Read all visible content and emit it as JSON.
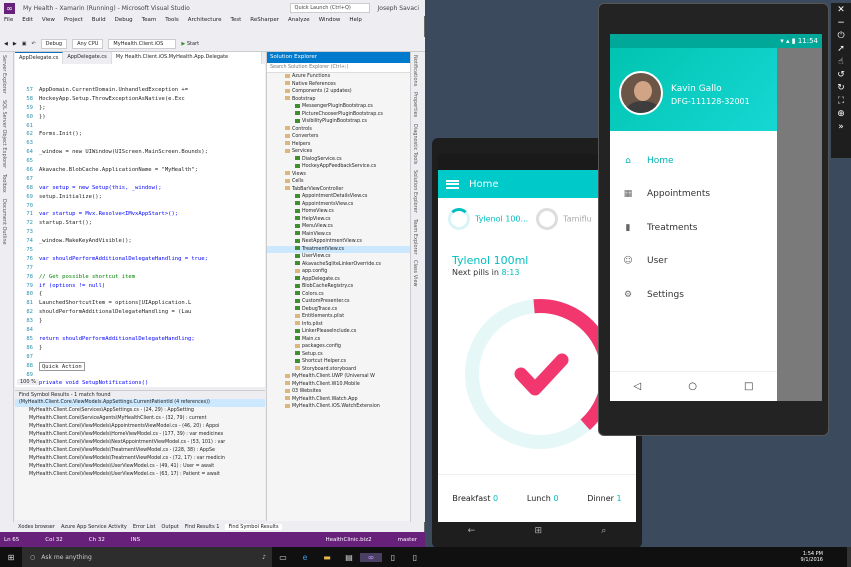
{
  "vs": {
    "title": "My Health - Xamarin (Running) - Microsoft Visual Studio",
    "menu": [
      "File",
      "Edit",
      "View",
      "Project",
      "Build",
      "Debug",
      "Team",
      "Tools",
      "Architecture",
      "Test",
      "ReSharper",
      "Analyze",
      "Window",
      "Help"
    ],
    "user": "Joseph Savaci",
    "quick_launch": "Quick Launch (Ctrl+Q)",
    "toolbar": {
      "config": "Debug",
      "platform": "Any CPU",
      "project": "MyHealth.Client.iOS",
      "start": "Start"
    },
    "side_tabs": [
      "Server Explorer",
      "SQL Server Object Explorer",
      "Toolbox",
      "Document Outline"
    ],
    "right_tabs": [
      "Notifications",
      "Properties",
      "Diagnostic Tools",
      "Solution Explorer",
      "Team Explorer",
      "Class View"
    ],
    "tabs": [
      "AppDelegate.cs",
      "AppDelegate.cs",
      "My Health.Client.iOS.MyHealth.App.Delegate"
    ],
    "code": [
      {
        "n": "57",
        "t": "AppDomain.CurrentDomain.UnhandledException +="
      },
      {
        "n": "58",
        "t": "    HockeyApp.Setup.ThrowExceptionAsNative(e.Exc"
      },
      {
        "n": "59",
        "t": "};"
      },
      {
        "n": "60",
        "t": "})"
      },
      {
        "n": "61",
        "t": ""
      },
      {
        "n": "62",
        "t": "Forms.Init();"
      },
      {
        "n": "63",
        "t": ""
      },
      {
        "n": "64",
        "t": "_window = new UIWindow(UIScreen.MainScreen.Bounds);"
      },
      {
        "n": "65",
        "t": ""
      },
      {
        "n": "66",
        "t": "Akavache.BlobCache.ApplicationName = \"MyHealth\";"
      },
      {
        "n": "67",
        "t": ""
      },
      {
        "n": "68",
        "t": "var setup = new Setup(this, _window);"
      },
      {
        "n": "69",
        "t": "setup.Initialize();"
      },
      {
        "n": "70",
        "t": ""
      },
      {
        "n": "71",
        "t": "var startup = Mvx.Resolve<IMvxAppStart>();"
      },
      {
        "n": "72",
        "t": "startup.Start();"
      },
      {
        "n": "73",
        "t": ""
      },
      {
        "n": "74",
        "t": "_window.MakeKeyAndVisible();"
      },
      {
        "n": "75",
        "t": ""
      },
      {
        "n": "76",
        "t": "var shouldPerformAdditionalDelegateHandling = true;"
      },
      {
        "n": "77",
        "t": ""
      },
      {
        "n": "78",
        "t": "// Get possible shortcut item"
      },
      {
        "n": "79",
        "t": "if (options != null)"
      },
      {
        "n": "80",
        "t": "{"
      },
      {
        "n": "81",
        "t": "    LaunchedShortcutItem = options[UIApplication.L"
      },
      {
        "n": "82",
        "t": "    shouldPerformAdditionalDelegateHandling = (Lau"
      },
      {
        "n": "83",
        "t": "}"
      },
      {
        "n": "84",
        "t": ""
      },
      {
        "n": "85",
        "t": "return shouldPerformAdditionalDelegateHandling;"
      },
      {
        "n": "86",
        "t": "}"
      },
      {
        "n": "87",
        "t": ""
      },
      {
        "n": "88",
        "t": "Quick Action"
      },
      {
        "n": "89",
        "t": ""
      },
      {
        "n": "177",
        "t": "private void SetupNotifications()"
      }
    ],
    "zoom": "100 %",
    "find_title": "Find Symbol Results - 1 match found",
    "find_rows": [
      "(MyHealth.Client.Core.ViewModels.AppSettings.CurrentPatientId (4 references))",
      "MyHealth.Client.Core\\Services\\AppSettings.cs - (24, 29) : AppSetting",
      "MyHealth.Client.Core\\ServiceAgents\\MyHealthClient.cs - (32, 79) : current",
      "MyHealth.Client.Core\\ViewModels\\AppointmentsViewModel.cs - (46, 20) : Appoi",
      "MyHealth.Client.Core\\ViewModels\\HomeViewModel.cs - (177, 39) : var medicines",
      "MyHealth.Client.Core\\ViewModels\\NextAppointmentViewModel.cs - (53, 101) : var",
      "MyHealth.Client.Core\\ViewModels\\TreatmentViewModel.cs - (228, 38) : AppSe",
      "MyHealth.Client.Core\\ViewModels\\TreatmentViewModel.cs - (72, 17) : var medicin",
      "MyHealth.Client.Core\\ViewModels\\UserViewModel.cs - (49, 41) : User = await",
      "MyHealth.Client.Core\\ViewModels\\UserViewModel.cs - (63, 17) : Patient = await"
    ],
    "bottom_tabs": [
      "Xodes browser",
      "Azure App Service Activity",
      "Error List",
      "Output",
      "Find Results 1",
      "Find Symbol Results"
    ],
    "status": {
      "ln": "Ln 65",
      "col": "Col 32",
      "ch": "Ch 32",
      "mode": "INS",
      "branch": "master",
      "project": "HealthClinic.biz2"
    },
    "solution": {
      "title": "Solution Explorer",
      "search": "Search Solution Explorer (Ctrl+;)",
      "items": [
        "Azure Functions",
        "Native References",
        "Components (2 updates)",
        "Bootstrap",
        "MessengerPluginBootstrap.cs",
        "PictureChooserPluginBootstrap.cs",
        "VisibilityPluginBootstrap.cs",
        "Controls",
        "Converters",
        "Helpers",
        "Services",
        "DialogService.cs",
        "HockeyAppFeedbackService.cs",
        "Views",
        "Cells",
        "TabBarViewController",
        "AppointmentDetailsView.cs",
        "AppointmentsView.cs",
        "HomeView.cs",
        "HelpView.cs",
        "MenuView.cs",
        "MainView.cs",
        "NextAppointmentView.cs",
        "TreatmentView.cs",
        "UserView.cs",
        "AkavacheSqliteLinkerOverride.cs",
        "app.config",
        "AppDelegate.cs",
        "BlobCacheRegistry.cs",
        "Colors.cs",
        "CustomPresenter.cs",
        "DebugTrace.cs",
        "Entitlements.plist",
        "Info.plist",
        "LinkerPleaseInclude.cs",
        "Main.cs",
        "packages.config",
        "Setup.cs",
        "Shortcut Helper.cs",
        "Storyboard.storyboard",
        "MyHealth.Client.UWP (Universal W",
        "MyHealth.Client.W10.Mobile",
        "03 Websites",
        "MyHealth.Client.Watch.App",
        "MyHealth.Client.iOS.WatchExtension"
      ]
    }
  },
  "phone1": {
    "app_title": "Home",
    "pill1": "Tylenol 100...",
    "pill2": "Tamiflu",
    "card_title": "Tylenol 100ml",
    "next_label": "Next pills in",
    "next_time": "8:13",
    "daily": [
      {
        "label": "Breakfast",
        "v": "0"
      },
      {
        "label": "Lunch",
        "v": "0"
      },
      {
        "label": "Dinner",
        "v": "1"
      }
    ],
    "accent": "#00c9c9"
  },
  "phone2": {
    "status_time": "11:54",
    "name": "Kavin Gallo",
    "id": "DFG-111128-32001",
    "menu": [
      "Home",
      "Appointments",
      "Treatments",
      "User",
      "Settings"
    ],
    "accent": "#00b2b2"
  },
  "taskbar": {
    "search": "Ask me anything",
    "time": "1:54 PM",
    "date": "9/1/2016"
  }
}
